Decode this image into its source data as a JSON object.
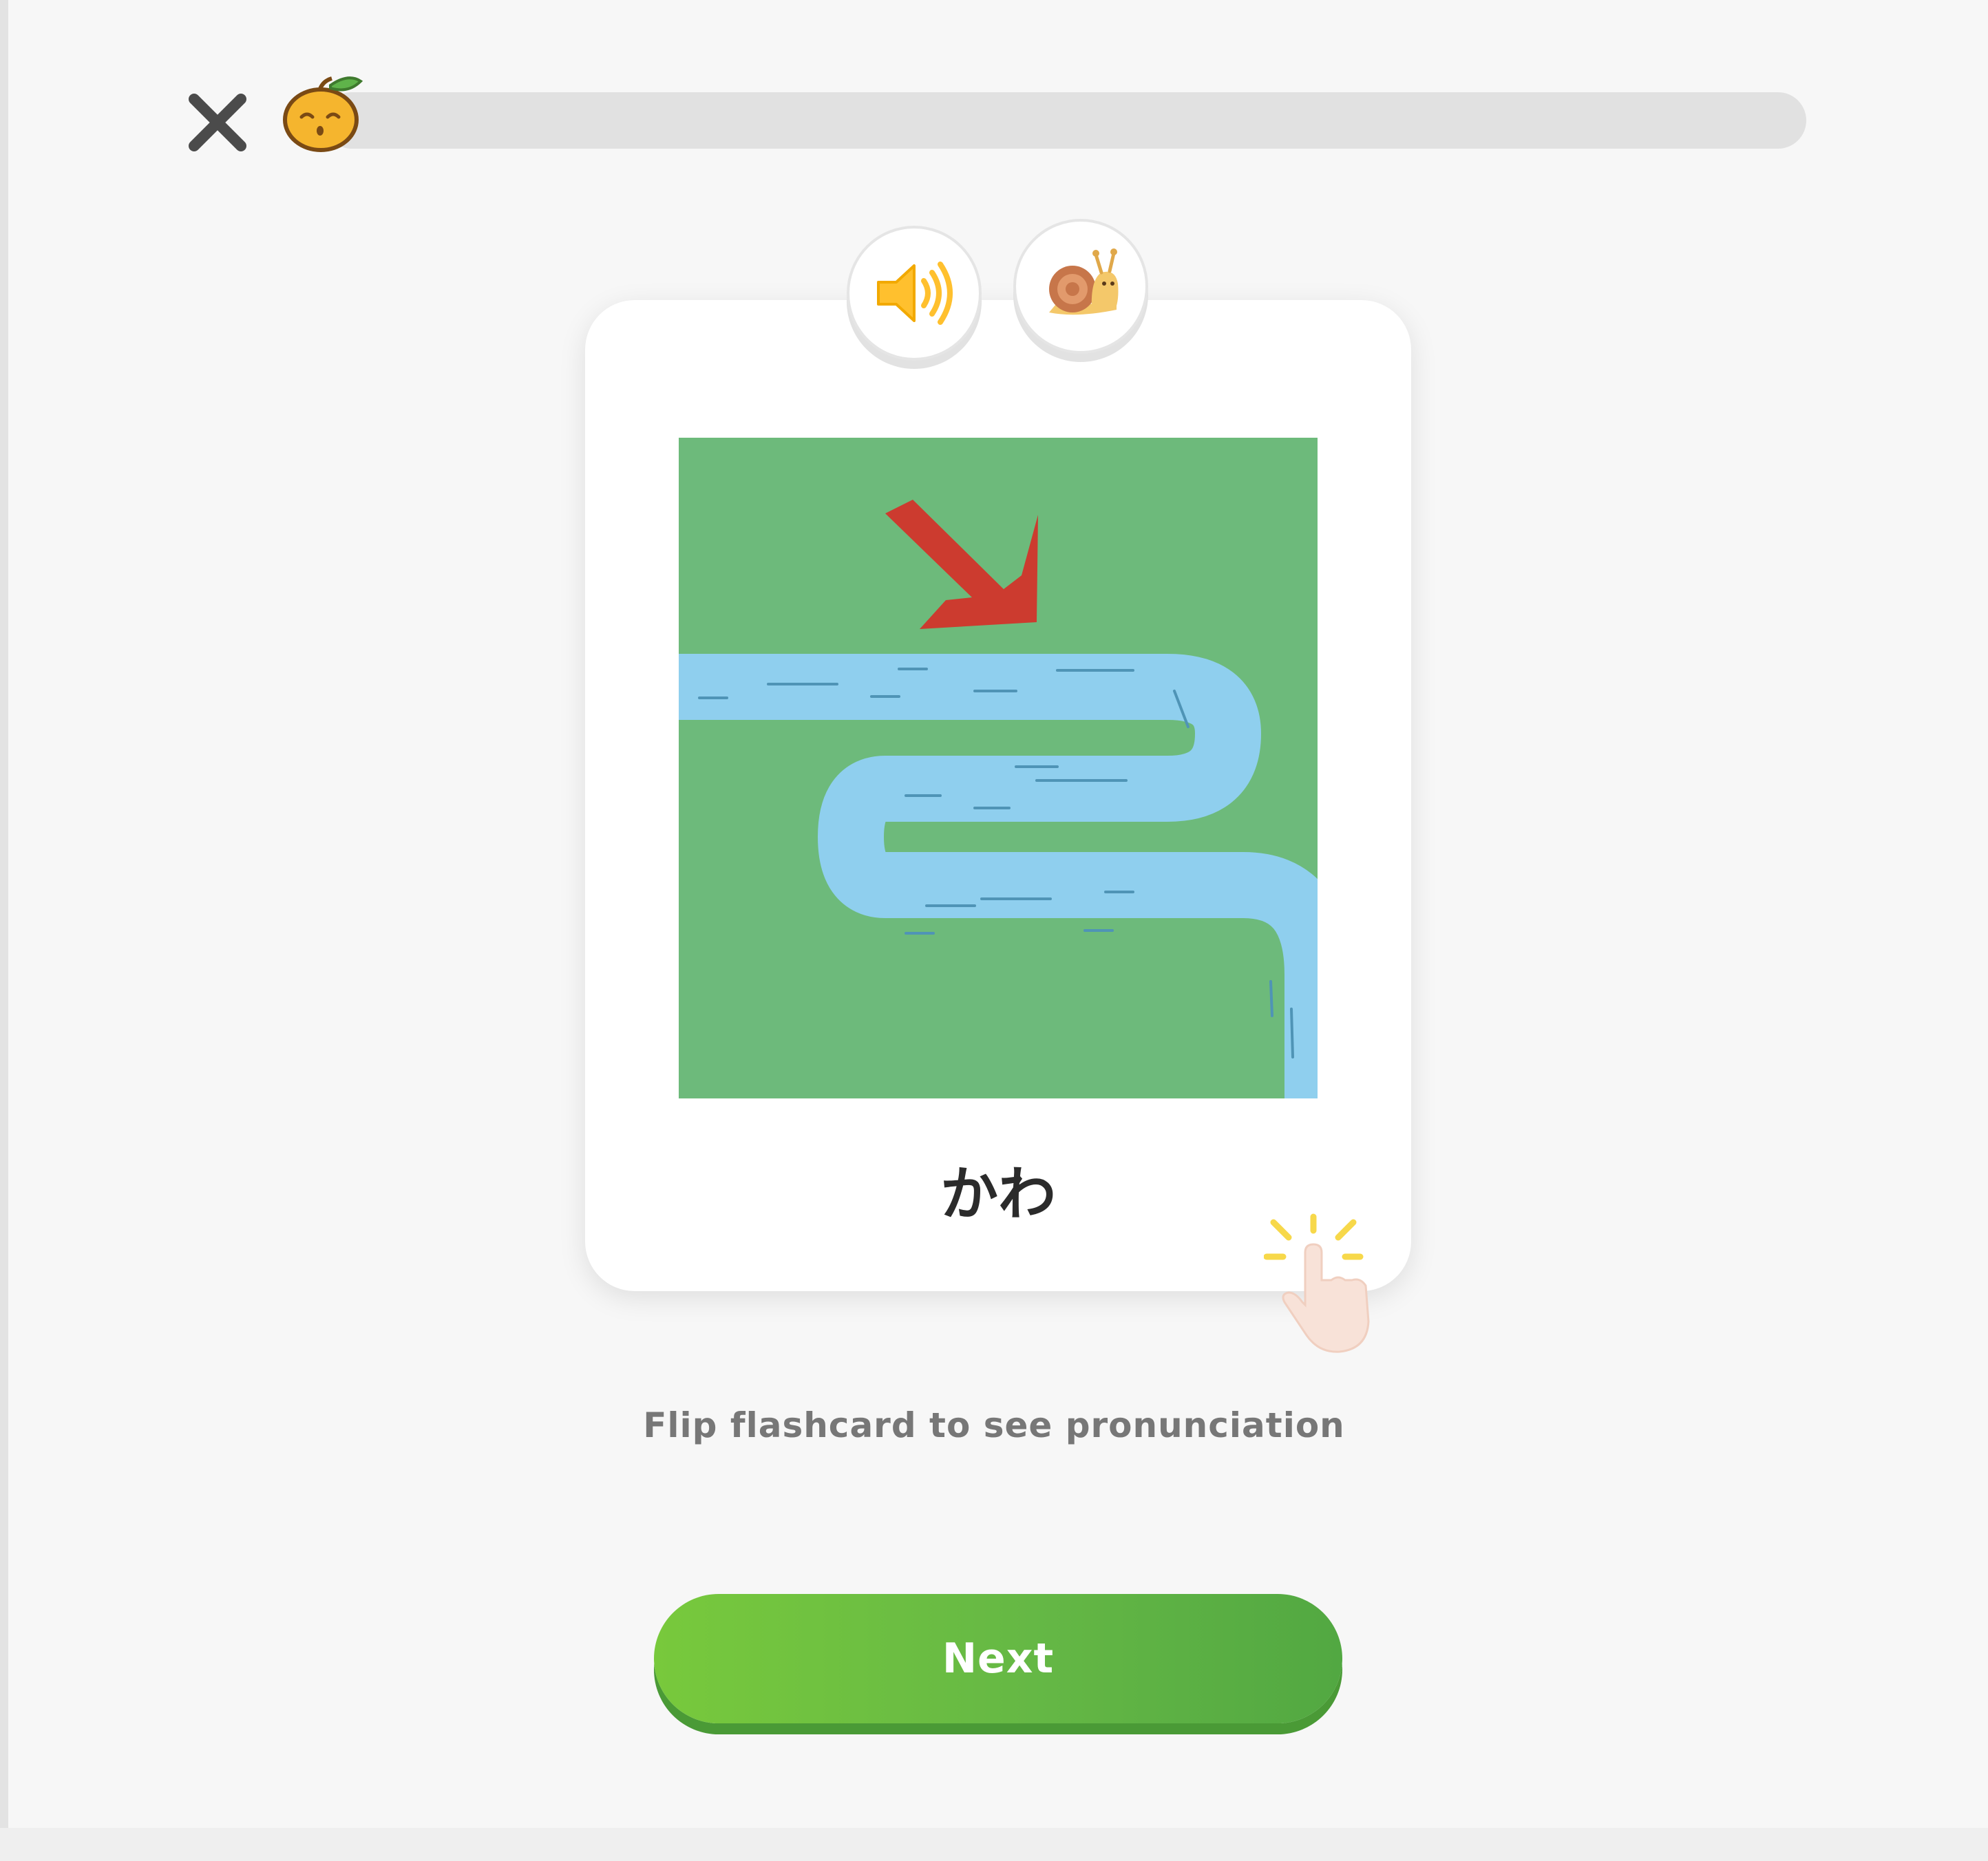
{
  "header": {
    "close_icon": "close-icon",
    "mascot_icon": "orange-mascot-icon",
    "progress": 0.0,
    "progress_color": "#ffc800"
  },
  "audio": {
    "play_icon": "speaker-icon",
    "slow_icon": "snail-icon"
  },
  "flashcard": {
    "image_icon": "river-illustration-icon",
    "word": "かわ",
    "tap_hint_icon": "tap-hand-icon"
  },
  "instruction": "Flip flashcard to see pronunciation",
  "next_button": {
    "label": "Next",
    "color": "#6bbd42"
  }
}
